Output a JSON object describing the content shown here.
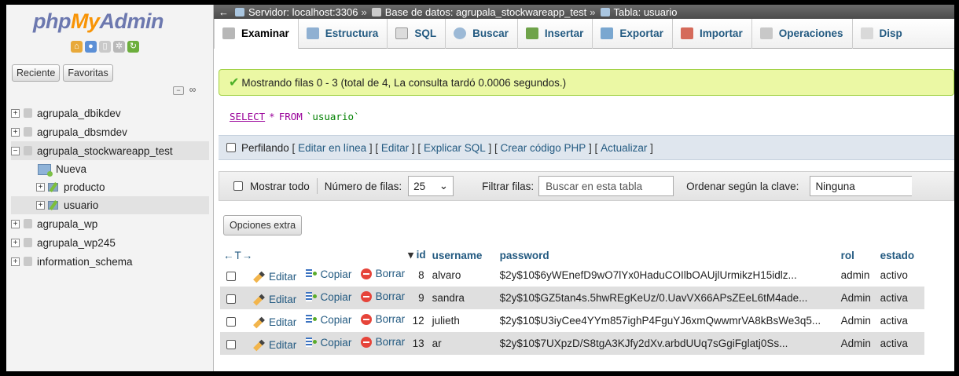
{
  "logo": {
    "php": "php",
    "my": "My",
    "admin": "Admin"
  },
  "nav": {
    "tabs": [
      "Reciente",
      "Favoritas"
    ],
    "databases": [
      {
        "name": "agrupala_dbikdev",
        "expanded": false
      },
      {
        "name": "agrupala_dbsmdev",
        "expanded": false
      },
      {
        "name": "agrupala_stockwareapp_test",
        "expanded": true
      },
      {
        "name": "agrupala_wp",
        "expanded": false
      },
      {
        "name": "agrupala_wp245",
        "expanded": false
      },
      {
        "name": "information_schema",
        "expanded": false
      }
    ],
    "new_label": "Nueva",
    "tables": [
      "producto",
      "usuario"
    ]
  },
  "breadcrumb": {
    "server": "Servidor: localhost:3306",
    "database": "Base de datos: agrupala_stockwareapp_test",
    "table": "Tabla: usuario"
  },
  "menu": [
    "Examinar",
    "Estructura",
    "SQL",
    "Buscar",
    "Insertar",
    "Exportar",
    "Importar",
    "Operaciones",
    "Disp"
  ],
  "notice": "Mostrando filas 0 - 3 (total de 4, La consulta tardó 0.0006 segundos.)",
  "sql": {
    "select": "SELECT",
    "star": "*",
    "from": "FROM",
    "table": "`usuario`"
  },
  "profiling": {
    "label": "Perfilando",
    "links": [
      "Editar en línea",
      "Editar",
      "Explicar SQL",
      "Crear código PHP",
      "Actualizar"
    ]
  },
  "controls": {
    "show_all": "Mostrar todo",
    "rows_label": "Número de filas:",
    "rows_value": "25",
    "filter_label": "Filtrar filas:",
    "filter_placeholder": "Buscar en esta tabla",
    "sort_label": "Ordenar según la clave:",
    "sort_value": "Ninguna"
  },
  "extra_options": "Opciones extra",
  "table": {
    "arrows": "←T→",
    "columns": [
      "id",
      "username",
      "password",
      "rol",
      "estado"
    ],
    "actions": {
      "edit": "Editar",
      "copy": "Copiar",
      "delete": "Borrar"
    },
    "rows": [
      {
        "id": "8",
        "username": "alvaro",
        "password": "$2y$10$6yWEnefD9wO7lYx0HaduCOIlbOAUjlUrmikzH15idlz...",
        "rol": "admin",
        "estado": "activo"
      },
      {
        "id": "9",
        "username": "sandra",
        "password": "$2y$10$GZ5tan4s.5hwREgKeUz/0.UavVX66APsZEeL6tM4ade...",
        "rol": "Admin",
        "estado": "activa"
      },
      {
        "id": "12",
        "username": "julieth",
        "password": "$2y$10$U3iyCee4YYm857ighP4FguYJ6xmQwwmrVA8kBsWe3q5...",
        "rol": "Admin",
        "estado": "activa"
      },
      {
        "id": "13",
        "username": "ar",
        "password": "$2y$10$7UXpzD/S8tgA3KJfy2dXv.arbdUUq7sGgiFglatj0Ss...",
        "rol": "Admin",
        "estado": "activa"
      }
    ]
  }
}
